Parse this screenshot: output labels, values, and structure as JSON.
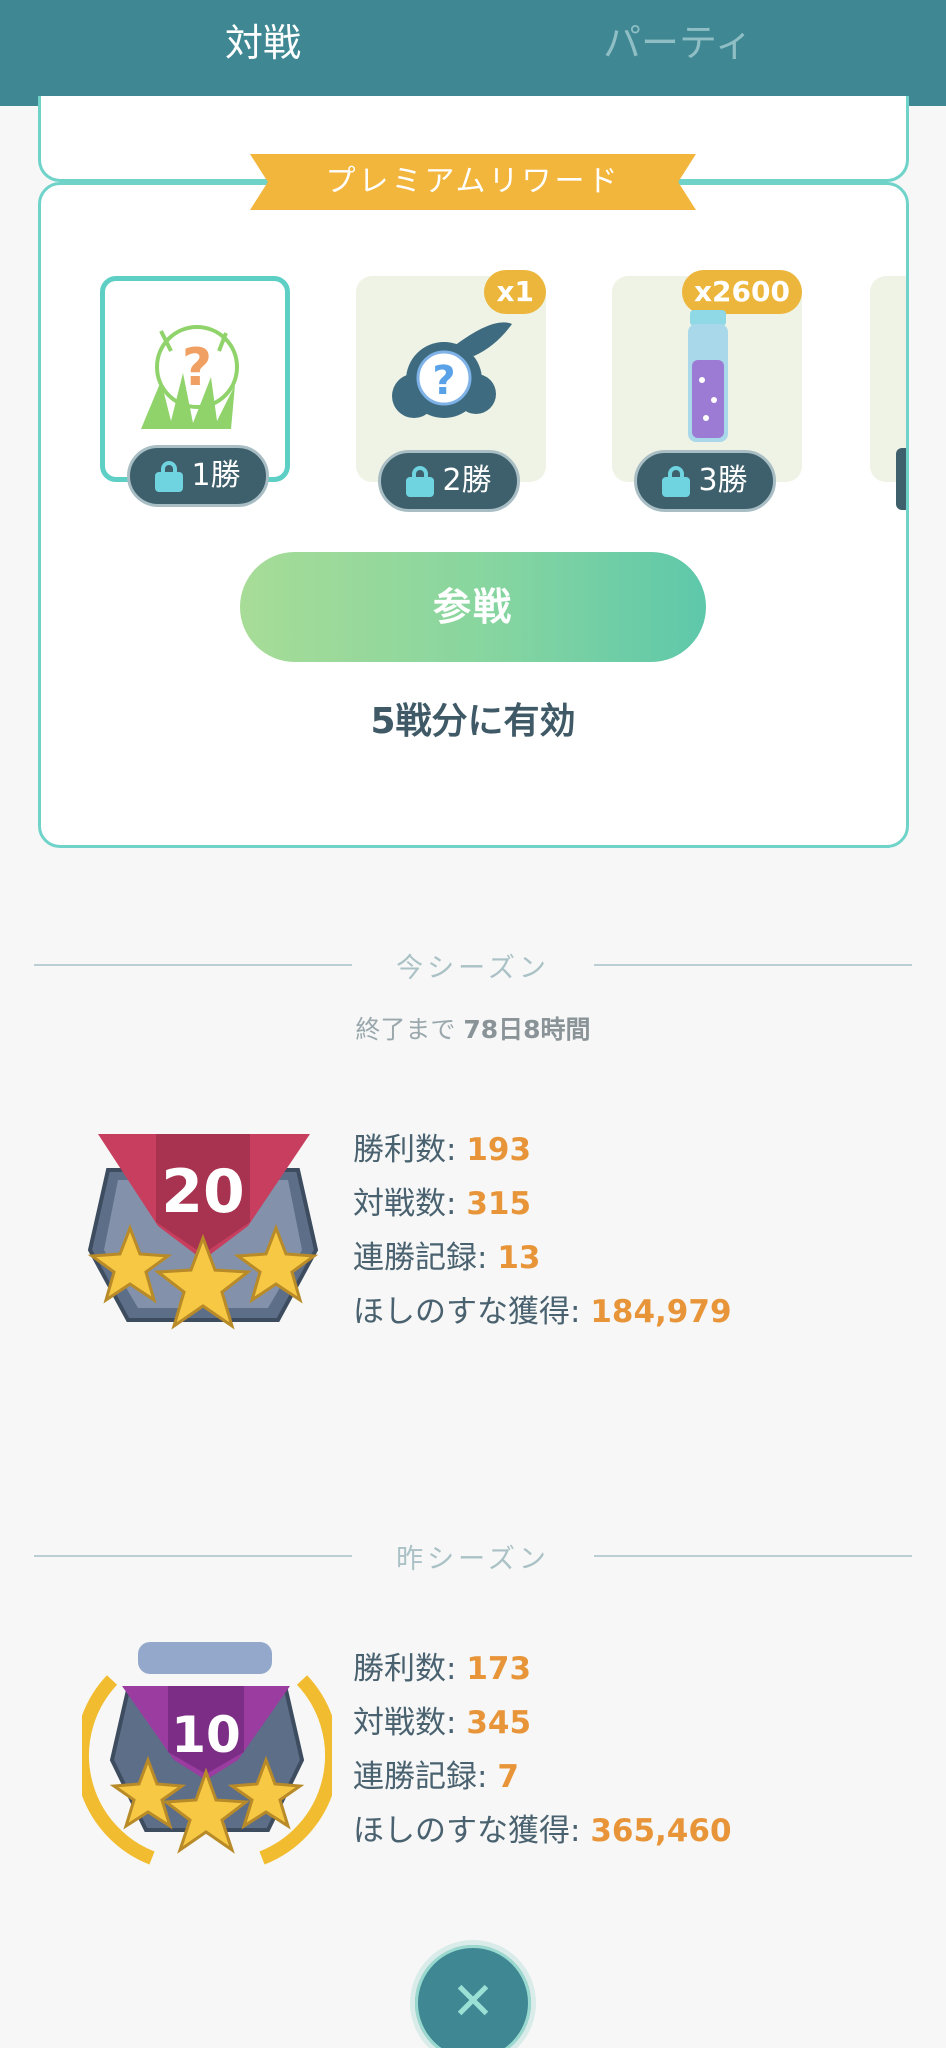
{
  "tabs": {
    "battle": "対戦",
    "party": "パーティ"
  },
  "rewards": {
    "ribbon": "プレミアムリワード",
    "items": [
      {
        "icon": "grass-encounter-icon",
        "count": "",
        "wins": "1勝"
      },
      {
        "icon": "stardust-mystery-icon",
        "count": "x1",
        "wins": "2勝"
      },
      {
        "icon": "stardust-vial-icon",
        "count": "x2600",
        "wins": "3勝"
      }
    ],
    "join_label": "参戦",
    "valid_text": "5戦分に有効"
  },
  "current_season": {
    "label": "今シーズン",
    "end_prefix": "終了まで ",
    "end_value": "78日8時間",
    "rank": "20",
    "stats": [
      {
        "label": "勝利数:",
        "value": "193"
      },
      {
        "label": "対戦数:",
        "value": "315"
      },
      {
        "label": "連勝記録:",
        "value": "13"
      },
      {
        "label": "ほしのすな獲得:",
        "value": "184,979"
      }
    ]
  },
  "previous_season": {
    "label": "昨シーズン",
    "rank": "10",
    "stats": [
      {
        "label": "勝利数:",
        "value": "173"
      },
      {
        "label": "対戦数:",
        "value": "345"
      },
      {
        "label": "連勝記録:",
        "value": "7"
      },
      {
        "label": "ほしのすな獲得:",
        "value": "365,460"
      }
    ]
  },
  "close_symbol": "✕",
  "colors": {
    "header": "#3e8793",
    "card_border": "#6fd3c9",
    "accent_value": "#e8953a",
    "ribbon": "#f2b63c"
  }
}
